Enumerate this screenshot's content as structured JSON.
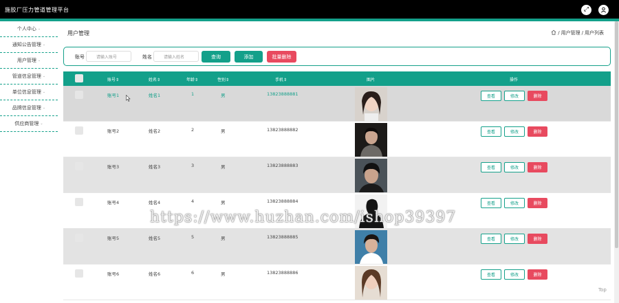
{
  "app": {
    "title": "施胶厂压力管道管理平台",
    "icons": [
      "expand-icon",
      "user-avatar-icon"
    ]
  },
  "sidebar": {
    "items": [
      {
        "label": "个人中心",
        "caret": "⌄"
      },
      {
        "label": "通知公告管理",
        "caret": "⌄"
      },
      {
        "label": "用户管理",
        "caret": "⌄"
      },
      {
        "label": "管道信息管理",
        "caret": "⌄"
      },
      {
        "label": "单位信息管理",
        "caret": "⌄"
      },
      {
        "label": "品牌信息管理",
        "caret": "⌄"
      },
      {
        "label": "供应商管理",
        "caret": "⌄"
      }
    ]
  },
  "page": {
    "title": "用户管理",
    "breadcrumb": [
      "用户管理",
      "用户列表"
    ],
    "separator": "/"
  },
  "search": {
    "account_label": "账号",
    "account_placeholder": "请输入账号",
    "name_label": "姓名",
    "name_placeholder": "请输入姓名",
    "query_button": "查询",
    "add_button": "添加",
    "batch_delete_button": "批量删除"
  },
  "table": {
    "headers": [
      "账号⇕",
      "姓名⇕",
      "年龄⇕",
      "性别⇕",
      "手机⇕",
      "图片",
      "操作"
    ],
    "rows": [
      {
        "account": "账号1",
        "name": "姓名1",
        "age": "1",
        "gender": "男",
        "phone": "13823888881"
      },
      {
        "account": "账号2",
        "name": "姓名2",
        "age": "2",
        "gender": "男",
        "phone": "13823888882"
      },
      {
        "account": "账号3",
        "name": "姓名3",
        "age": "3",
        "gender": "男",
        "phone": "13823888883"
      },
      {
        "account": "账号4",
        "name": "姓名4",
        "age": "4",
        "gender": "男",
        "phone": "13823888884"
      },
      {
        "account": "账号5",
        "name": "姓名5",
        "age": "5",
        "gender": "男",
        "phone": "13823888885"
      },
      {
        "account": "账号6",
        "name": "姓名6",
        "age": "6",
        "gender": "男",
        "phone": "13823888886"
      }
    ],
    "actions": {
      "view": "查看",
      "edit": "修改",
      "delete": "删除"
    }
  },
  "watermark": "https://www.huzhan.com/ishop39397",
  "scroll_top_label": "Top",
  "colors": {
    "accent": "#13a08a",
    "danger": "#e84a5f",
    "topbar": "#000000"
  }
}
